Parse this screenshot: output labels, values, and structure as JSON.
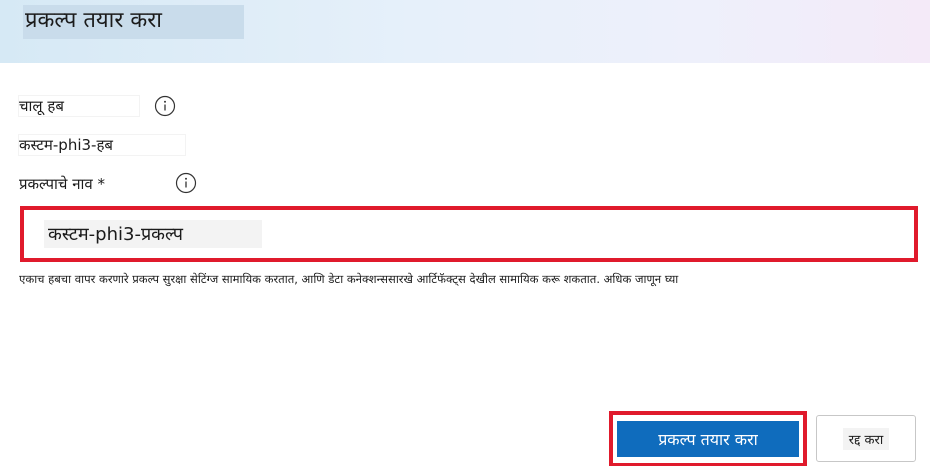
{
  "dialog": {
    "title": "प्रकल्प तयार करा"
  },
  "hub": {
    "label": "चालू हब",
    "value": "कस्टम-phi3-हब",
    "info_icon": "info-icon"
  },
  "project_name": {
    "label": "प्रकल्पाचे नाव *",
    "value": "कस्टम-phi3-प्रकल्प",
    "info_icon": "info-icon"
  },
  "description": "एकाच हबचा वापर करणारे प्रकल्प सुरक्षा सेटिंग्ज सामायिक करतात, आणि डेटा कनेक्शन्ससारखे आर्टिफॅक्ट्स देखील सामायिक करू शकतात. अधिक जाणून घ्या",
  "buttons": {
    "create": "प्रकल्प तयार करा",
    "cancel": "रद्द करा"
  },
  "colors": {
    "primary": "#0f6cbd",
    "highlight": "#e01a2c"
  }
}
